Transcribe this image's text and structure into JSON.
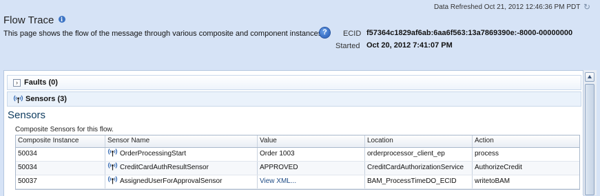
{
  "header": {
    "data_refreshed": "Data Refreshed Oct 21, 2012 12:46:36 PM PDT",
    "title": "Flow Trace",
    "description": "This page shows the flow of the message through various composite and component instances.",
    "ecid_label": "ECID",
    "ecid_value": "f57364c1829af6ab:6aa6f563:13a7869390e:-8000-00000000",
    "started_label": "Started",
    "started_value": "Oct 20, 2012 7:41:07 PM"
  },
  "accordions": {
    "faults": "Faults (0)",
    "sensors": "Sensors (3)"
  },
  "sensors": {
    "title": "Sensors",
    "caption": "Composite Sensors for this flow.",
    "columns": [
      "Composite Instance",
      "Sensor Name",
      "Value",
      "Location",
      "Action"
    ],
    "rows": [
      [
        "50034",
        "OrderProcessingStart",
        "Order 1003",
        "orderprocessor_client_ep",
        "process"
      ],
      [
        "50034",
        "CreditCardAuthResultSensor",
        "APPROVED",
        "CreditCardAuthorizationService",
        "AuthorizeCredit"
      ],
      [
        "50037",
        "AssignedUserForApprovalSensor",
        "View XML...",
        "BAM_ProcessTimeDO_ECID",
        "writetoBAM"
      ]
    ]
  },
  "icons": {
    "refresh": "refresh-icon",
    "info": "info-icon",
    "help": "help-icon",
    "sensor": "sensor-antenna-icon"
  },
  "colors": {
    "header_bg": "#d6e3f6",
    "link": "#1f4c86",
    "section_title": "#0c3a5e"
  }
}
